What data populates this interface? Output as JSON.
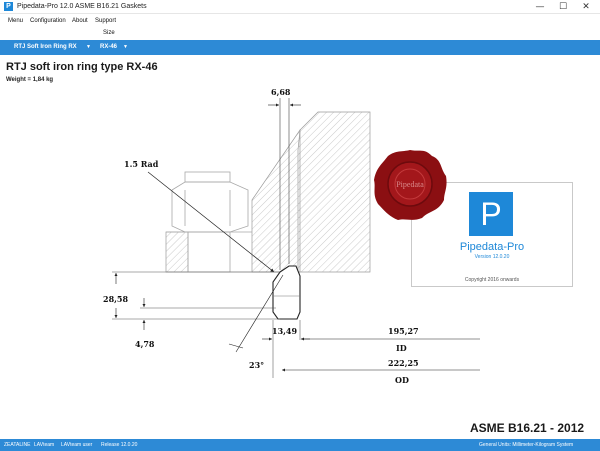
{
  "window": {
    "title": "Pipedata-Pro 12.0 ASME B16.21 Gaskets",
    "icon_letter": "P",
    "minimize": "—",
    "maximize": "☐",
    "close": "✕"
  },
  "menu": {
    "items": [
      "Menu",
      "Configuration",
      "About",
      "Support"
    ],
    "sub_label": "Size"
  },
  "selector": {
    "gasket_type": "RTJ Soft Iron Ring RX",
    "size": "RX-46",
    "caret": "▼"
  },
  "gasket": {
    "title": "RTJ soft iron ring type RX-46",
    "weight": "Weight =  1,84 kg"
  },
  "dimensions": {
    "top_width": "6,68",
    "radius": "1.5 Rad",
    "height": "28,58",
    "flat": "4,78",
    "angle": "23°",
    "width": "13,49",
    "id_value": "195,27",
    "id_label": "ID",
    "od_value": "222,25",
    "od_label": "OD"
  },
  "splash": {
    "logo_letter": "P",
    "product": "Pipedata-Pro",
    "version": "Version 12.0.20",
    "copyright": "Copyright  2016 onwards",
    "seal_text": "Pipedata"
  },
  "standard": "ASME B16.21 - 2012",
  "status": {
    "company": "ZEATALINE",
    "team": "LAVteam",
    "user": "LAVteam user",
    "release": "Release 12.0.20",
    "units": "General Units: Millimeter-Kilogram System"
  },
  "colors": {
    "accent": "#2d8ad6",
    "logo_blue": "#1e88d8",
    "seal_red": "#8b0f12",
    "hatch": "#b5b5b5"
  }
}
